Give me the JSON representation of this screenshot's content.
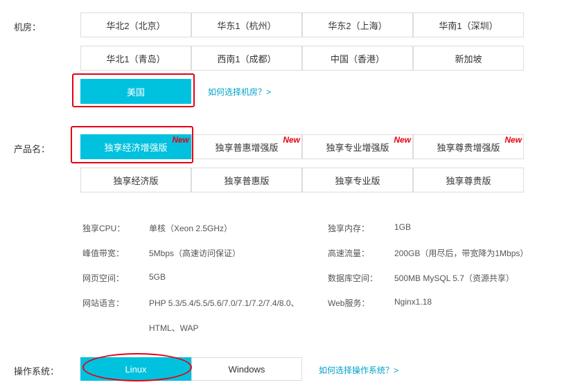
{
  "datacenter": {
    "label": "机房：",
    "options": [
      "华北2（北京）",
      "华东1（杭州）",
      "华东2（上海）",
      "华南1（深圳）",
      "华北1（青岛）",
      "西南1（成都）",
      "中国（香港）",
      "新加坡",
      "美国"
    ],
    "help_link": "如何选择机房？>"
  },
  "product": {
    "label": "产品名：",
    "options": [
      "独享经济增强版",
      "独享普惠增强版",
      "独享专业增强版",
      "独享尊贵增强版",
      "独享经济版",
      "独享普惠版",
      "独享专业版",
      "独享尊贵版"
    ],
    "new_badge": "New"
  },
  "specs": {
    "left": [
      {
        "label": "独享CPU：",
        "value": "单核（Xeon 2.5GHz）"
      },
      {
        "label": "峰值带宽：",
        "value": "5Mbps（高速访问保证）"
      },
      {
        "label": "网页空间：",
        "value": "5GB"
      },
      {
        "label": "网站语言：",
        "value": "PHP 5.3/5.4/5.5/5.6/7.0/7.1/7.2/7.4/8.0、",
        "value2": "HTML、WAP"
      }
    ],
    "right": [
      {
        "label": "独享内存：",
        "value": "1GB"
      },
      {
        "label": "高速流量：",
        "value": "200GB（用尽后，带宽降为1Mbps）"
      },
      {
        "label": "数据库空间：",
        "value": "500MB MySQL 5.7（资源共享）"
      },
      {
        "label": "Web服务：",
        "value": "Nginx1.18"
      }
    ]
  },
  "os": {
    "label": "操作系统：",
    "options": [
      "Linux",
      "Windows"
    ],
    "help_link": "如何选择操作系统？>"
  },
  "colors": {
    "accent": "#00c1de",
    "highlight": "#e60012",
    "link": "#00a2ca"
  }
}
